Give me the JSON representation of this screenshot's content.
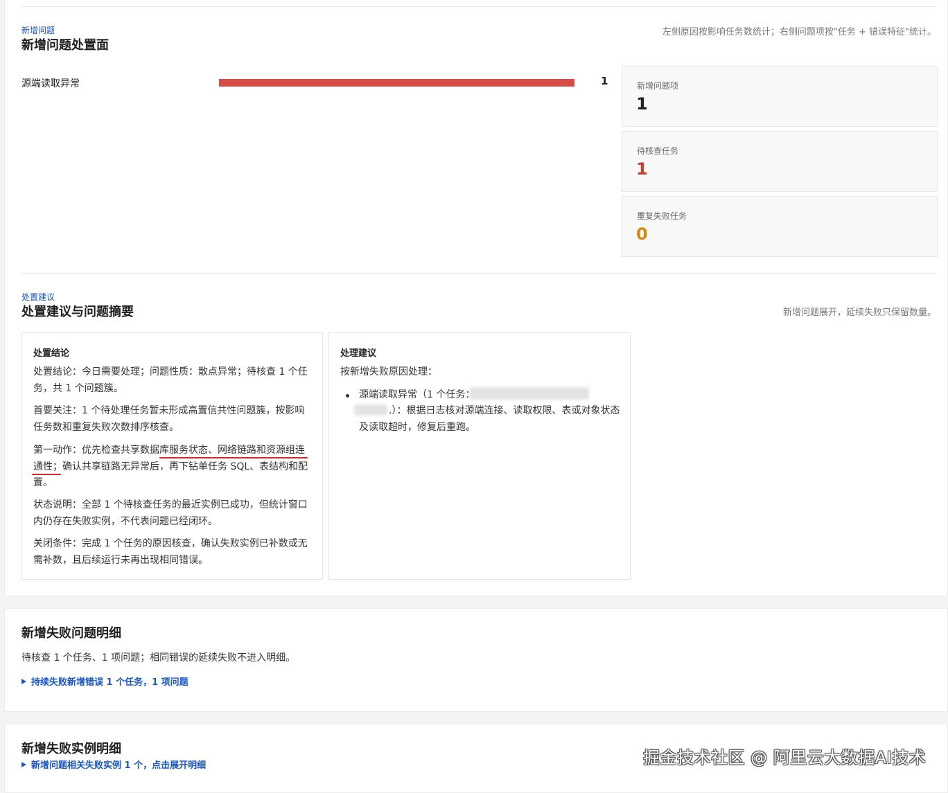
{
  "new_issues": {
    "eyebrow": "新增问题",
    "title": "新增问题处置面",
    "hint": "左侧原因按影响任务数统计；右侧问题项按\"任务 + 错误特征\"统计。",
    "bars": [
      {
        "label": "源端读取异常",
        "value": 1,
        "fraction": 1.0
      }
    ],
    "stats": [
      {
        "label": "新增问题项",
        "value": "1",
        "color": "#222222"
      },
      {
        "label": "待核查任务",
        "value": "1",
        "color": "#cc3b33"
      },
      {
        "label": "重复失败任务",
        "value": "0",
        "color": "#d68910"
      }
    ]
  },
  "advice": {
    "eyebrow": "处置建议",
    "title": "处置建议与问题摘要",
    "hint": "新增问题展开，延续失败只保留数量。",
    "conclusion": {
      "title": "处置结论",
      "p1": "处置结论：今日需要处理；问题性质：散点异常；待核查 1 个任务，共 1 个问题簇。",
      "p2": "首要关注：1 个待处理任务暂未形成高置信共性问题簇，按影响任务数和重复失败次数排序核查。",
      "p3": "第一动作：优先检查共享数据库服务状态、网络链路和资源组连通性；确认共享链路无异常后，再下钻单任务 SQL、表结构和配置。",
      "p4": "状态说明：全部 1 个待核查任务的最近实例已成功，但统计窗口内仍存在失败实例，不代表问题已经闭环。",
      "p5": "关闭条件：完成 1 个任务的原因核查，确认失败实例已补数或无需补数，且后续运行未再出现相同错误。"
    },
    "suggestion": {
      "title": "处理建议",
      "intro": "按新增失败原因处理：",
      "item_head": "源端读取异常（1 个任务：",
      "item_tail": ".）：根据日志核对源端连接、读取权限、表或对象状态及读取超时，修复后重跑。"
    }
  },
  "failure_detail": {
    "title": "新增失败问题明细",
    "summary": "待核查 1 个任务、1 项问题；相同错误的延续失败不进入明细。",
    "link": "持续失败新增错误 1 个任务，1 项问题"
  },
  "instance_detail": {
    "title": "新增失败实例明细",
    "link": "新增问题相关失败实例 1 个，点击展开明细"
  },
  "watermark": "掘金技术社区 @ 阿里云大数据AI技术"
}
